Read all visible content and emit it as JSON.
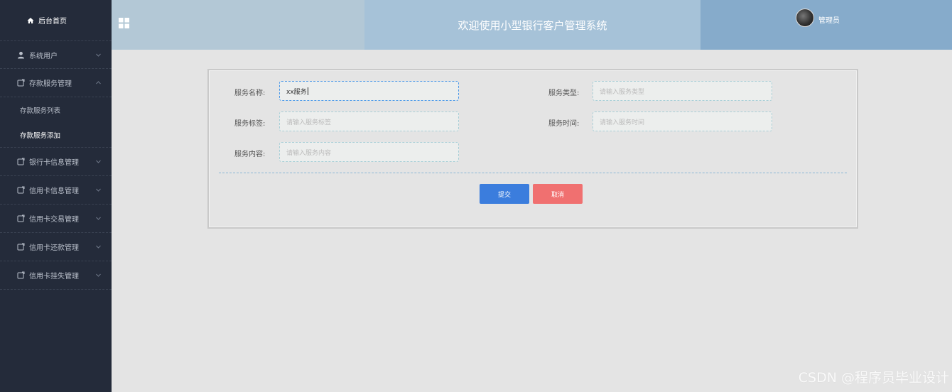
{
  "sidebar": {
    "home": {
      "label": "后台首页",
      "icon": "home-icon"
    },
    "items": [
      {
        "label": "系统用户",
        "icon": "user-icon"
      },
      {
        "label": "存款服务管理",
        "icon": "folder-icon",
        "expanded": true,
        "children": [
          {
            "label": "存款服务列表"
          },
          {
            "label": "存款服务添加",
            "active": true
          }
        ]
      },
      {
        "label": "银行卡信息管理",
        "icon": "folder-icon"
      },
      {
        "label": "信用卡信息管理",
        "icon": "folder-icon"
      },
      {
        "label": "信用卡交易管理",
        "icon": "folder-icon"
      },
      {
        "label": "信用卡还款管理",
        "icon": "folder-icon"
      },
      {
        "label": "信用卡挂失管理",
        "icon": "folder-icon"
      }
    ]
  },
  "header": {
    "title": "欢迎使用小型银行客户管理系统",
    "user": "管理员",
    "colors": {
      "left": "#b3c8d6",
      "middle": "#a6c2d8",
      "right": "#86abcb"
    }
  },
  "form": {
    "fields": {
      "name": {
        "label": "服务名称:",
        "value": "xx服务",
        "placeholder": ""
      },
      "type": {
        "label": "服务类型:",
        "value": "",
        "placeholder": "请输入服务类型"
      },
      "tag": {
        "label": "服务标签:",
        "value": "",
        "placeholder": "请输入服务标签"
      },
      "time": {
        "label": "服务时间:",
        "value": "",
        "placeholder": "请输入服务时间"
      },
      "content": {
        "label": "服务内容:",
        "value": "",
        "placeholder": "请输入服务内容"
      }
    },
    "submit_label": "提交",
    "cancel_label": "取消"
  },
  "watermark": "CSDN @程序员毕业设计"
}
